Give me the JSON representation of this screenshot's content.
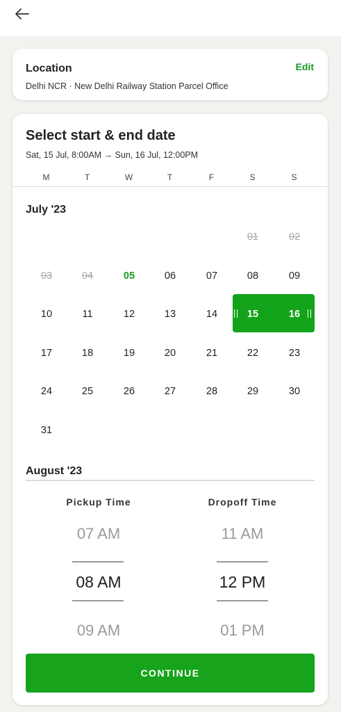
{
  "header": {
    "back_icon": "arrow-left-icon"
  },
  "location": {
    "title": "Location",
    "edit_label": "Edit",
    "address": "Delhi NCR · New Delhi Railway Station Parcel Office"
  },
  "date_picker": {
    "title": "Select start & end date",
    "range_text": "Sat, 15 Jul, 8:00AM → Sun, 16 Jul, 12:00PM",
    "weekdays": [
      "M",
      "T",
      "W",
      "T",
      "F",
      "S",
      "S"
    ],
    "july": {
      "label": "July '23",
      "row1": [
        "01",
        "02"
      ],
      "row2": [
        "03",
        "04",
        "05",
        "06",
        "07",
        "08",
        "09"
      ],
      "row3": [
        "10",
        "11",
        "12",
        "13",
        "14",
        "15",
        "16"
      ],
      "row4": [
        "17",
        "18",
        "19",
        "20",
        "21",
        "22",
        "23"
      ],
      "row5": [
        "24",
        "25",
        "26",
        "27",
        "28",
        "29",
        "30"
      ],
      "row6": [
        "31"
      ]
    },
    "august": {
      "label": "August '23"
    }
  },
  "time": {
    "pickup_label": "Pickup Time",
    "dropoff_label": "Dropoff Time",
    "pickup": {
      "prev": "07 AM",
      "selected": "08 AM",
      "next": "09 AM"
    },
    "dropoff": {
      "prev": "11 AM",
      "selected": "12 PM",
      "next": "01 PM"
    }
  },
  "continue_label": "CONTINUE",
  "colors": {
    "accent": "#17a31c",
    "today": "#1a9a22",
    "disabled": "#a8a8a8"
  }
}
